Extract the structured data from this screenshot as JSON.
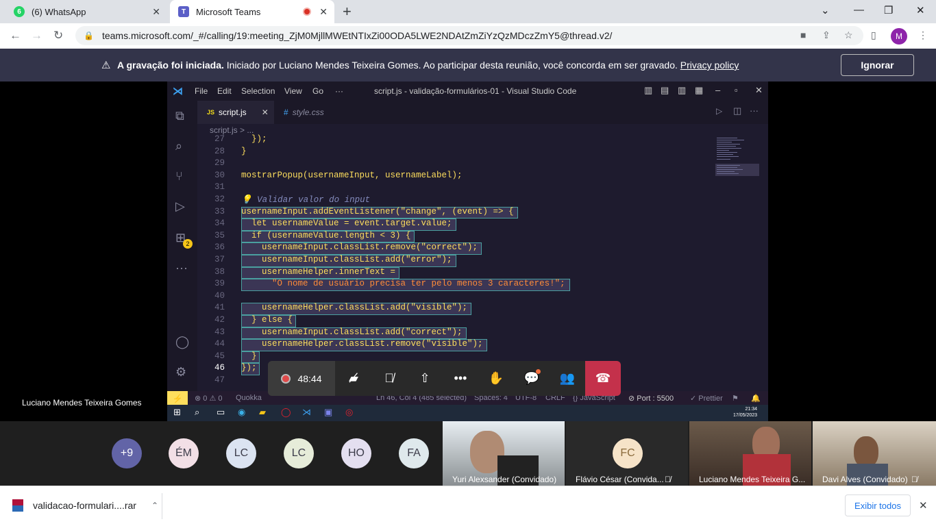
{
  "browser": {
    "tabs": [
      {
        "title": "(6) WhatsApp",
        "badge": "6",
        "icon": "whatsapp-icon",
        "color": "#25d366"
      },
      {
        "title": "Microsoft Teams",
        "icon": "teams-icon",
        "color": "#5b5fc7"
      }
    ],
    "url": "teams.microsoft.com/_#/calling/19:meeting_ZjM0MjllMWEtNTIxZi00ODA5LWE2NDAtZmZiYzQzMDczZmY5@thread.v2/",
    "profile_initial": "M"
  },
  "banner": {
    "bold": "A gravação foi iniciada.",
    "text": " Iniciado por Luciano Mendes Teixeira Gomes. Ao participar desta reunião, você concorda em ser gravado. ",
    "link": "Privacy policy",
    "ignore_label": "Ignorar"
  },
  "vscode": {
    "menu": [
      "File",
      "Edit",
      "Selection",
      "View",
      "Go",
      "···"
    ],
    "title": "script.js - validação-formulários-01 - Visual Studio Code",
    "tabs": [
      {
        "icon": "JS",
        "label": "script.js"
      },
      {
        "icon": "#",
        "label": "style.css"
      }
    ],
    "breadcrumb": "script.js > ...",
    "extensions_badge": "2",
    "lines": [
      {
        "n": "27",
        "code": "  });"
      },
      {
        "n": "28",
        "code": "}"
      },
      {
        "n": "29",
        "code": ""
      },
      {
        "n": "30",
        "code": "mostrarPopup(usernameInput, usernameLabel);"
      },
      {
        "n": "31",
        "code": ""
      },
      {
        "n": "32",
        "code": "💡 Validar valor do input"
      },
      {
        "n": "33",
        "code": "usernameInput.addEventListener(\"change\", (event) => {"
      },
      {
        "n": "34",
        "code": "  let usernameValue = event.target.value;"
      },
      {
        "n": "35",
        "code": "  if (usernameValue.length < 3) {"
      },
      {
        "n": "36",
        "code": "    usernameInput.classList.remove(\"correct\");"
      },
      {
        "n": "37",
        "code": "    usernameInput.classList.add(\"error\");"
      },
      {
        "n": "38",
        "code": "    usernameHelper.innerText ="
      },
      {
        "n": "39",
        "code": "      \"O nome de usuário precisa ter pelo menos 3 caracteres!\";"
      },
      {
        "n": "40",
        "code": ""
      },
      {
        "n": "41",
        "code": "    usernameHelper.classList.add(\"visible\");"
      },
      {
        "n": "42",
        "code": "  } else {"
      },
      {
        "n": "43",
        "code": "    usernameInput.classList.add(\"correct\");"
      },
      {
        "n": "44",
        "code": "    usernameHelper.classList.remove(\"visible\");"
      },
      {
        "n": "45",
        "code": "  }"
      },
      {
        "n": "46",
        "code": "});"
      },
      {
        "n": "47",
        "code": ""
      }
    ],
    "status": {
      "errors": "⊗ 0 ⚠ 0",
      "quokka": "Quokka",
      "cursor": "Ln 46, Col 4 (485 selected)",
      "spaces": "Spaces: 4",
      "encoding": "UTF-8",
      "eol": "CRLF",
      "lang": "{} JavaScript",
      "port": "⊘ Port : 5500",
      "prettier": "✓ Prettier"
    }
  },
  "taskbar": {
    "time": "21:34",
    "date": "17/05/2023"
  },
  "call": {
    "timer": "48:44",
    "presenter_name": "Luciano Mendes Teixeira Gomes"
  },
  "participants": {
    "overflow": "+9",
    "avatars": [
      {
        "initials": "ÉM",
        "color": "#f2dfe6"
      },
      {
        "initials": "LC",
        "color": "#dbe3f1"
      },
      {
        "initials": "LC",
        "color": "#e6ecd9"
      },
      {
        "initials": "HO",
        "color": "#e4dff0"
      },
      {
        "initials": "FA",
        "color": "#dfe9ec"
      }
    ],
    "tiles": [
      {
        "name": "Yuri Alexsander (Convidado)"
      },
      {
        "name": "Flávio César (Convida...",
        "initials": "FC"
      },
      {
        "name": "Luciano Mendes Teixeira G..."
      },
      {
        "name": "Davi Alves (Convidado)"
      }
    ]
  },
  "download": {
    "file": "validacao-formulari....rar",
    "show_all": "Exibir todos"
  }
}
